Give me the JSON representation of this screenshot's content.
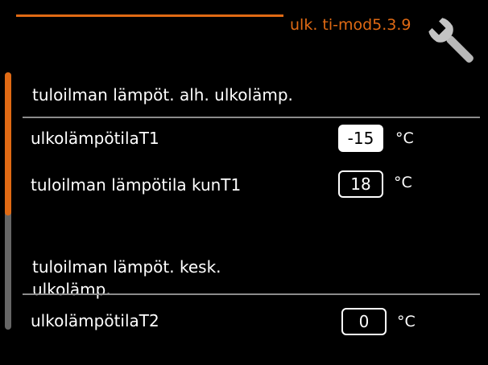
{
  "header": {
    "title": "ulk. ti-mod5.3.9",
    "icon": "wrench-icon",
    "accent_color": "#e06a14"
  },
  "sections": [
    {
      "title": "tuloilman lämpöt. alh. ulkolämp.",
      "rows": [
        {
          "label": "ulkolämpötilaT1",
          "value": "-15",
          "unit": "°C",
          "selected": true
        },
        {
          "label": "tuloilman lämpötila kunT1",
          "value": "18",
          "unit": "°C",
          "selected": false
        }
      ]
    },
    {
      "title": "tuloilman lämpöt. kesk. ulkolämp.",
      "rows": [
        {
          "label": "ulkolämpötilaT2",
          "value": "0",
          "unit": "°C",
          "selected": false
        }
      ]
    }
  ]
}
